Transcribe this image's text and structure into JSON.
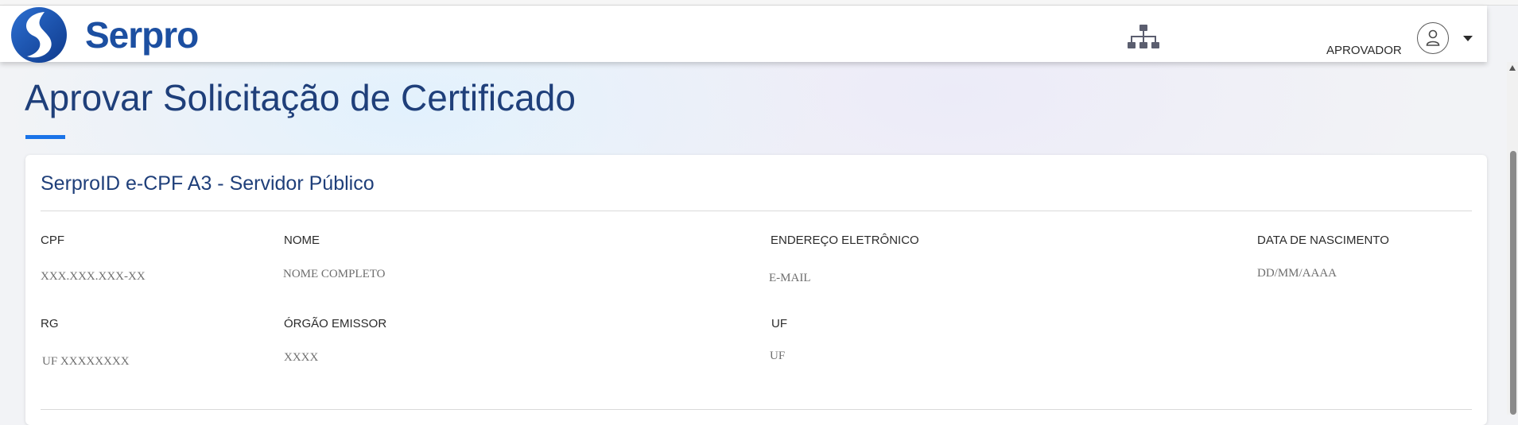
{
  "header": {
    "brand": "Serpro",
    "role": "APROVADOR",
    "icons": {
      "logo": "serpro-logo-icon",
      "sitemap": "sitemap-icon",
      "user": "user-icon",
      "dropdown": "caret-down-icon"
    },
    "colors": {
      "brand": "#1c4fa1",
      "accent": "#1a73e8",
      "title": "#1f3f7a"
    }
  },
  "page": {
    "title": "Aprovar Solicitação de Certificado"
  },
  "card": {
    "title": "SerproID e-CPF A3 - Servidor Público",
    "fields": {
      "cpf": {
        "label": "CPF",
        "value": "XXX.XXX.XXX-XX"
      },
      "nome": {
        "label": "NOME",
        "value": "NOME COMPLETO"
      },
      "email": {
        "label": "ENDEREÇO ELETRÔNICO",
        "value": "E-MAIL"
      },
      "nascimento": {
        "label": "DATA DE NASCIMENTO",
        "value": "DD/MM/AAAA"
      },
      "rg": {
        "label": "RG",
        "value": "UF XXXXXXXX"
      },
      "orgao": {
        "label": "ÓRGÃO EMISSOR",
        "value": "XXXX"
      },
      "uf": {
        "label": "UF",
        "value": "UF"
      }
    }
  }
}
